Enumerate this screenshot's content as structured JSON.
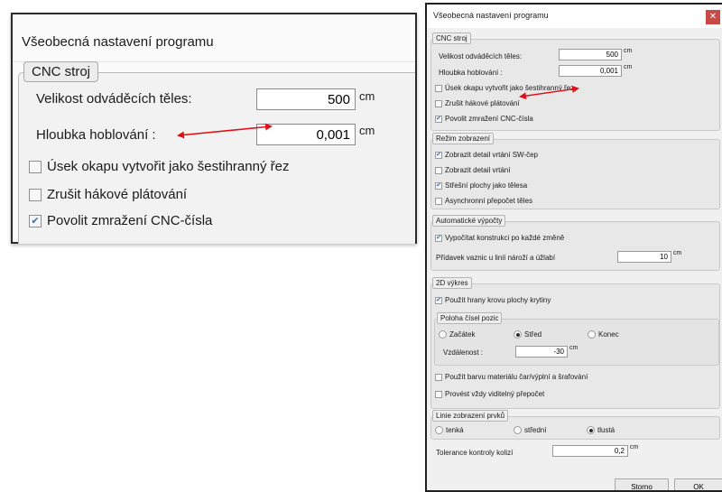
{
  "dialog_title": "Všeobecná nastavení programu",
  "cnc": {
    "legend": "CNC stroj",
    "size_label": "Velikost odváděcích těles:",
    "size_value": "500",
    "depth_label": "Hloubka hoblování :",
    "depth_value": "0,001",
    "unit": "cm",
    "eaves_label": "Úsek okapu vytvořit jako šestihranný řez",
    "hook_label": "Zrušit hákové plátování",
    "freeze_label": "Povolit zmražení CNC-čísla",
    "eaves_checked": false,
    "hook_checked": false,
    "freeze_checked": true
  },
  "display": {
    "legend": "Režim zobrazení",
    "items": [
      {
        "label": "Zobrazit detail vrtání SW-čep",
        "checked": true
      },
      {
        "label": "Zobrazit detail vrtání",
        "checked": false
      },
      {
        "label": "Střešní plochy jako tělesa",
        "checked": true
      },
      {
        "label": "Asynchronní přepočet těles",
        "checked": false
      }
    ]
  },
  "auto": {
    "legend": "Automatické výpočty",
    "recalc_label": "Vypočítat konstrukci po každé změně",
    "recalc_checked": true,
    "addition_label": "Přídavek vaznic u linií nároží a úžlabí",
    "addition_value": "10",
    "unit": "cm"
  },
  "drawing2d": {
    "legend": "2D výkres",
    "roof_edges_label": "Použít hrany krovu plochy krytiny",
    "roof_edges_checked": true,
    "position": {
      "legend": "Poloha čísel pozic",
      "options": [
        "Začátek",
        "Střed",
        "Konec"
      ],
      "selected": "Střed",
      "distance_label": "Vzdálenost :",
      "distance_value": "-30",
      "unit": "cm"
    },
    "material_color_label": "Použít barvu materiálu čar/výplní a šrafování",
    "material_color_checked": false,
    "visible_recalc_label": "Provést vždy viditelný přepočet",
    "visible_recalc_checked": false
  },
  "lines": {
    "legend": "Linie zobrazení prvků",
    "options": [
      "tenká",
      "střední",
      "tlustá"
    ],
    "selected": "tlustá"
  },
  "tolerance": {
    "label": "Tolerance kontroly kolizí",
    "value": "0,2",
    "unit": "cm"
  },
  "buttons": {
    "cancel": "Storno",
    "ok": "OK"
  },
  "colors": {
    "arrow": "#e0101a",
    "close": "#c94848",
    "checkmark": "#3a6fb3"
  },
  "icons": {
    "close": "close-icon",
    "check": "checkmark-icon"
  }
}
